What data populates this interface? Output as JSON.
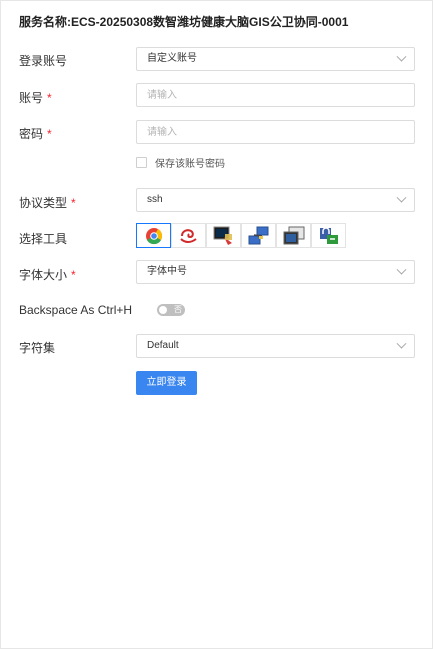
{
  "service": {
    "prefix": "服务名称:",
    "name": "ECS-20250308数智潍坊健康大脑GIS公卫协同-0001"
  },
  "form": {
    "login_account": {
      "label": "登录账号",
      "value": "自定义账号"
    },
    "account": {
      "label": "账号",
      "required_mark": "*",
      "placeholder": "请输入"
    },
    "password": {
      "label": "密码",
      "required_mark": "*",
      "placeholder": "请输入"
    },
    "save_password": {
      "label": "保存该账号密码",
      "checked": false
    },
    "protocol": {
      "label": "协议类型",
      "required_mark": "*",
      "value": "ssh"
    },
    "tool": {
      "label": "选择工具",
      "items": [
        {
          "name": "chrome-icon",
          "selected": true
        },
        {
          "name": "xshell-icon",
          "selected": false
        },
        {
          "name": "putty-icon",
          "selected": false
        },
        {
          "name": "network-transfer-icon",
          "selected": false
        },
        {
          "name": "remote-desktop-icon",
          "selected": false
        },
        {
          "name": "lock-key-icon",
          "selected": false
        }
      ]
    },
    "font_size": {
      "label": "字体大小",
      "required_mark": "*",
      "value": "字体中号"
    },
    "backspace": {
      "label": "Backspace As Ctrl+H",
      "toggle_text": "否",
      "on": false
    },
    "charset": {
      "label": "字符集",
      "value": "Default"
    },
    "submit_label": "立即登录"
  },
  "colors": {
    "accent": "#3a86f0",
    "required": "#f5222d",
    "border": "#dcdcdc"
  }
}
